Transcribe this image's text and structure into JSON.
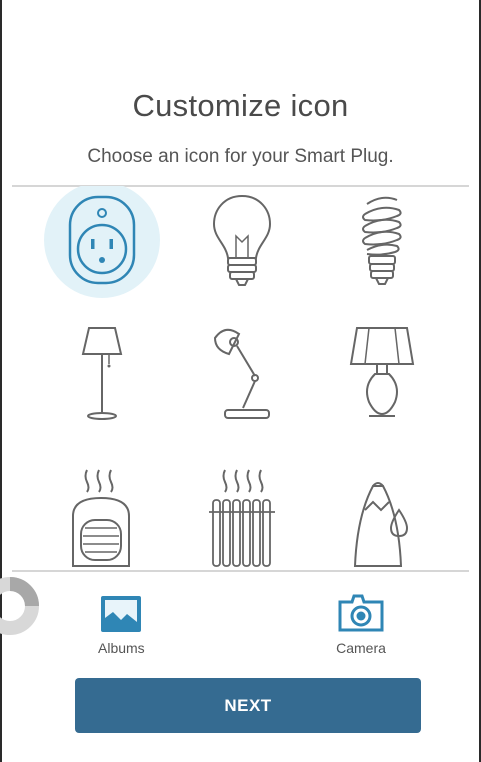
{
  "header": {
    "title": "Customize icon",
    "subtitle": "Choose an icon for your Smart Plug."
  },
  "icons": [
    {
      "name": "smart-plug",
      "selected": true
    },
    {
      "name": "light-bulb",
      "selected": false
    },
    {
      "name": "cfl-bulb",
      "selected": false
    },
    {
      "name": "floor-lamp",
      "selected": false
    },
    {
      "name": "desk-lamp",
      "selected": false
    },
    {
      "name": "table-lamp",
      "selected": false
    },
    {
      "name": "space-heater",
      "selected": false
    },
    {
      "name": "radiator",
      "selected": false
    },
    {
      "name": "humidifier",
      "selected": false
    }
  ],
  "toolbar": {
    "albums_label": "Albums",
    "camera_label": "Camera"
  },
  "actions": {
    "next_label": "NEXT"
  },
  "colors": {
    "accent": "#356b91",
    "icon_blue": "#2f86b5",
    "selected_bg": "#e2f2f8",
    "icon_line": "#666666"
  }
}
